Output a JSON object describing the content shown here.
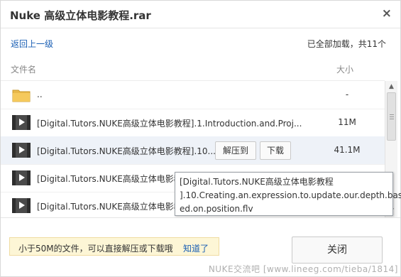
{
  "window": {
    "title": "Nuke 高级立体电影教程.rar",
    "close_glyph": "×"
  },
  "nav": {
    "back_label": "返回上一级",
    "status": "已全部加载，共11个"
  },
  "columns": {
    "name": "文件名",
    "size": "大小"
  },
  "rows": [
    {
      "icon": "folder-icon",
      "name": "..",
      "size": "-"
    },
    {
      "icon": "video-file-icon",
      "name": "[Digital.Tutors.NUKE高级立体电影教程].1.Introduction.and.Proj...",
      "size": "11M"
    },
    {
      "icon": "video-file-icon",
      "name": "[Digital.Tutors.NUKE高级立体电影教程].10...",
      "size": "41.1M",
      "actions": {
        "extract": "解压到",
        "download": "下载"
      }
    },
    {
      "icon": "video-file-icon",
      "name": "[Digital.Tutors.NUKE高级立体电影教",
      "size": ""
    },
    {
      "icon": "video-file-icon",
      "name": "[Digital.Tutors.NUKE高级立体电影教",
      "size": ""
    }
  ],
  "tooltip": {
    "lines": [
      "[Digital.Tutors.NUKE高级立体电影教程",
      "].10.Creating.an.expression.to.update.our.depth.bas",
      "ed.on.position.flv"
    ]
  },
  "footer": {
    "hint_text": "小于50M的文件，可以直接解压或下载哦",
    "hint_link": "知道了",
    "close_button": "关闭",
    "watermark": "NUKE交流吧 [www.lineeg.com/tieba/1814]"
  },
  "colors": {
    "accent_link": "#1a5fb4",
    "hover_row": "#eef2f8",
    "hint_bg": "#fdf6d6"
  }
}
